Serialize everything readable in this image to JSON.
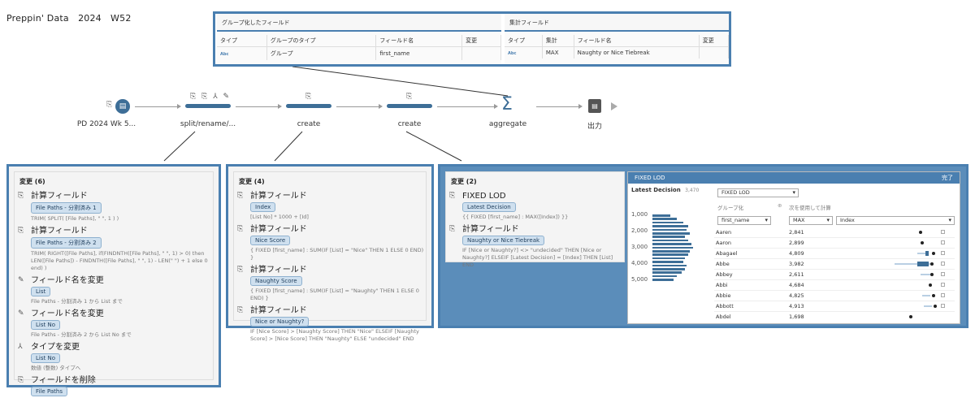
{
  "page_title": "Preppin' Data　2024　W52",
  "aggregate": {
    "grouped_title": "グループ化したフィールド",
    "grouped_headers": [
      "タイプ",
      "グループのタイプ",
      "フィールド名",
      "変更"
    ],
    "grouped_row": {
      "type_icon": "Abc",
      "group_type": "グループ",
      "field": "first_name",
      "change": ""
    },
    "agg_title": "集計フィールド",
    "agg_headers": [
      "タイプ",
      "集計",
      "フィールド名",
      "変更"
    ],
    "agg_row": {
      "type_icon": "Abc",
      "agg": "MAX",
      "field": "Naughty or Nice Tiebreak",
      "change": ""
    }
  },
  "flow": {
    "steps": [
      {
        "label": "PD 2024 Wk 5...",
        "icons": "⎘"
      },
      {
        "label": "split/rename/...",
        "icons": "⎘ ⎘ ⅄ ✎"
      },
      {
        "label": "create",
        "icons": "⎘"
      },
      {
        "label": "create",
        "icons": "⎘"
      },
      {
        "label": "aggregate",
        "icons": "Σ"
      },
      {
        "label": "出力",
        "icons": "▤"
      }
    ]
  },
  "panel1": {
    "title": "変更 (6)",
    "changes": [
      {
        "icon": "⎘",
        "name": "計算フィールド",
        "pill": "File Paths - 分割済み 1",
        "calc": "TRIM( SPLIT( [File Paths], \" \", 1 ) )"
      },
      {
        "icon": "⎘",
        "name": "計算フィールド",
        "pill": "File Paths - 分割済み 2",
        "calc": "TRIM( RIGHT([File Paths], if(FINDNTH([File Paths], \" \", 1) > 0) then LEN([File Paths]) - FINDNTH([File Paths], \" \", 1) - LEN(\" \") + 1 else 0 end) )"
      },
      {
        "icon": "✎",
        "name": "フィールド名を変更",
        "pill": "List",
        "calc": "File Paths - 分割済み 1 から List まで"
      },
      {
        "icon": "✎",
        "name": "フィールド名を変更",
        "pill": "List No",
        "calc": "File Paths - 分割済み 2 から List No まで"
      },
      {
        "icon": "⅄",
        "name": "タイプを変更",
        "pill": "List No",
        "calc": "数値 (整数) タイプへ"
      },
      {
        "icon": "⎘",
        "name": "フィールドを削除",
        "pill": "File Paths",
        "calc": ""
      }
    ]
  },
  "panel2": {
    "title": "変更 (4)",
    "changes": [
      {
        "icon": "⎘",
        "name": "計算フィールド",
        "pill": "Index",
        "calc": "[List No] * 1000 + [Id]"
      },
      {
        "icon": "⎘",
        "name": "計算フィールド",
        "pill": "Nice Score",
        "calc": "{ FIXED [first_name] : SUM(IF [List] = \"Nice\" THEN 1 ELSE 0 END) }"
      },
      {
        "icon": "⎘",
        "name": "計算フィールド",
        "pill": "Naughty Score",
        "calc": "{ FIXED [first_name] : SUM(IF [List] = \"Naughty\" THEN 1 ELSE 0 END) }"
      },
      {
        "icon": "⎘",
        "name": "計算フィールド",
        "pill": "Nice or Naughty?",
        "calc": "IF [Nice Score] > [Naughty Score] THEN \"Nice\" ELSEIF [Naughty Score] > [Nice Score] THEN \"Naughty\" ELSE \"undecided\" END"
      }
    ]
  },
  "panel3": {
    "title": "変更 (2)",
    "changes": [
      {
        "icon": "⎘",
        "name": "FIXED LOD",
        "pill": "Latest Decision",
        "calc": "{{ FIXED [first_name] : MAX([Index]) }}"
      },
      {
        "icon": "⎘",
        "name": "計算フィールド",
        "pill": "Naughty or Nice Tiebreak",
        "calc": "IF [Nice or Naughty?] <> \"undecided\" THEN [Nice or Naughty?] ELSEIF [Latest Decision] = [Index] THEN [List] END"
      }
    ]
  },
  "lod_editor": {
    "header": "FIXED LOD",
    "done": "完了",
    "field_title": "Latest Decision",
    "field_count": "3,470",
    "yticks": [
      "1,000",
      "2,000",
      "3,000",
      "4,000",
      "5,000"
    ],
    "type_select": "FIXED LOD",
    "group_label": "グループ化",
    "calc_label": "次を使用して計算",
    "group_field": "first_name",
    "agg_select": "MAX",
    "agg_field": "Index",
    "rows": [
      {
        "name": "Aaren",
        "value": "2,841"
      },
      {
        "name": "Aaron",
        "value": "2,899"
      },
      {
        "name": "Abagael",
        "value": "4,809"
      },
      {
        "name": "Abbe",
        "value": "3,982"
      },
      {
        "name": "Abbey",
        "value": "2,611"
      },
      {
        "name": "Abbi",
        "value": "4,684"
      },
      {
        "name": "Abbie",
        "value": "4,825"
      },
      {
        "name": "Abbott",
        "value": "4,913"
      },
      {
        "name": "Abdel",
        "value": "1,698"
      }
    ]
  }
}
